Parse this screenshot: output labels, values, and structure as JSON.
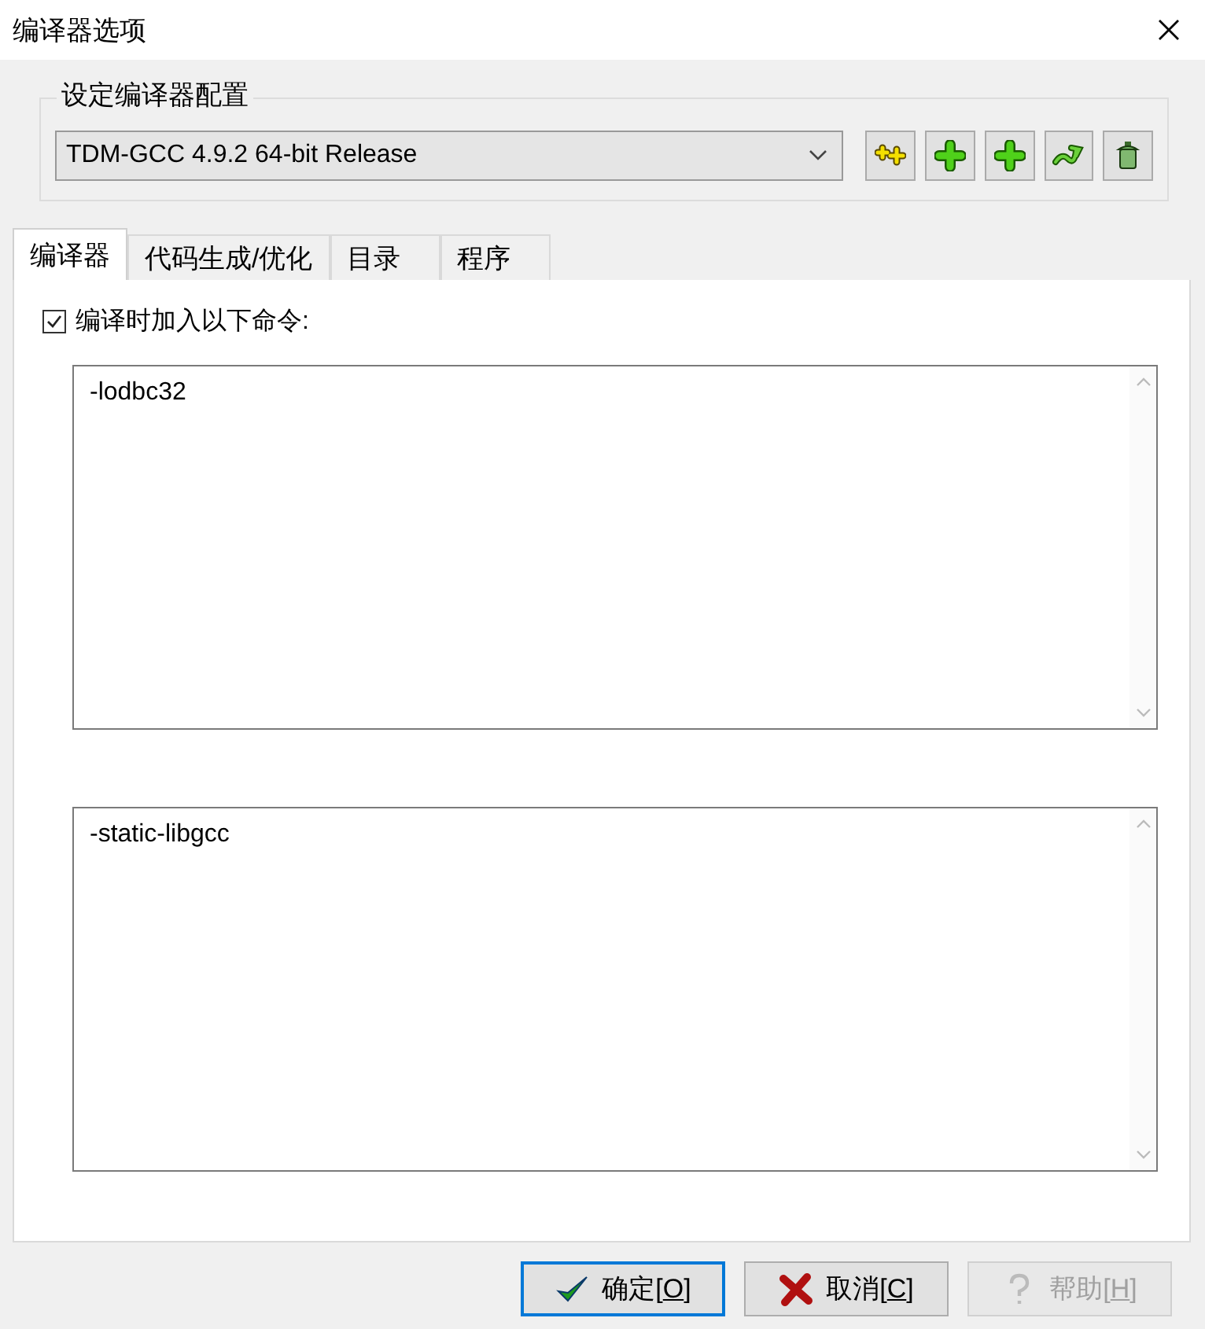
{
  "window": {
    "title": "编译器选项"
  },
  "config_group": {
    "title": "设定编译器配置",
    "selected_compiler": "TDM-GCC 4.9.2 64-bit Release",
    "tools": [
      {
        "kind": "double-plus"
      },
      {
        "kind": "plus"
      },
      {
        "kind": "plus"
      },
      {
        "kind": "arrow"
      },
      {
        "kind": "trash"
      }
    ]
  },
  "tabs": [
    {
      "label": "编译器",
      "selected": true
    },
    {
      "label": "代码生成/优化",
      "selected": false
    },
    {
      "label": "目录",
      "selected": false
    },
    {
      "label": "程序",
      "selected": false
    }
  ],
  "add_commands": {
    "label": "编译时加入以下命令:",
    "checked": true
  },
  "compiler_commands": {
    "value": "-lodbc32"
  },
  "linker_commands": {
    "value": "-static-libgcc"
  },
  "buttons": [
    {
      "kind": "ok",
      "before": "确定[",
      "accel": "O",
      "after": "]",
      "disabled": false,
      "focused": true
    },
    {
      "kind": "cancel",
      "before": "取消[",
      "accel": "C",
      "after": "]",
      "disabled": false,
      "focused": false
    },
    {
      "kind": "help",
      "before": "帮助[",
      "accel": "H",
      "after": "]",
      "disabled": true,
      "focused": false
    }
  ]
}
